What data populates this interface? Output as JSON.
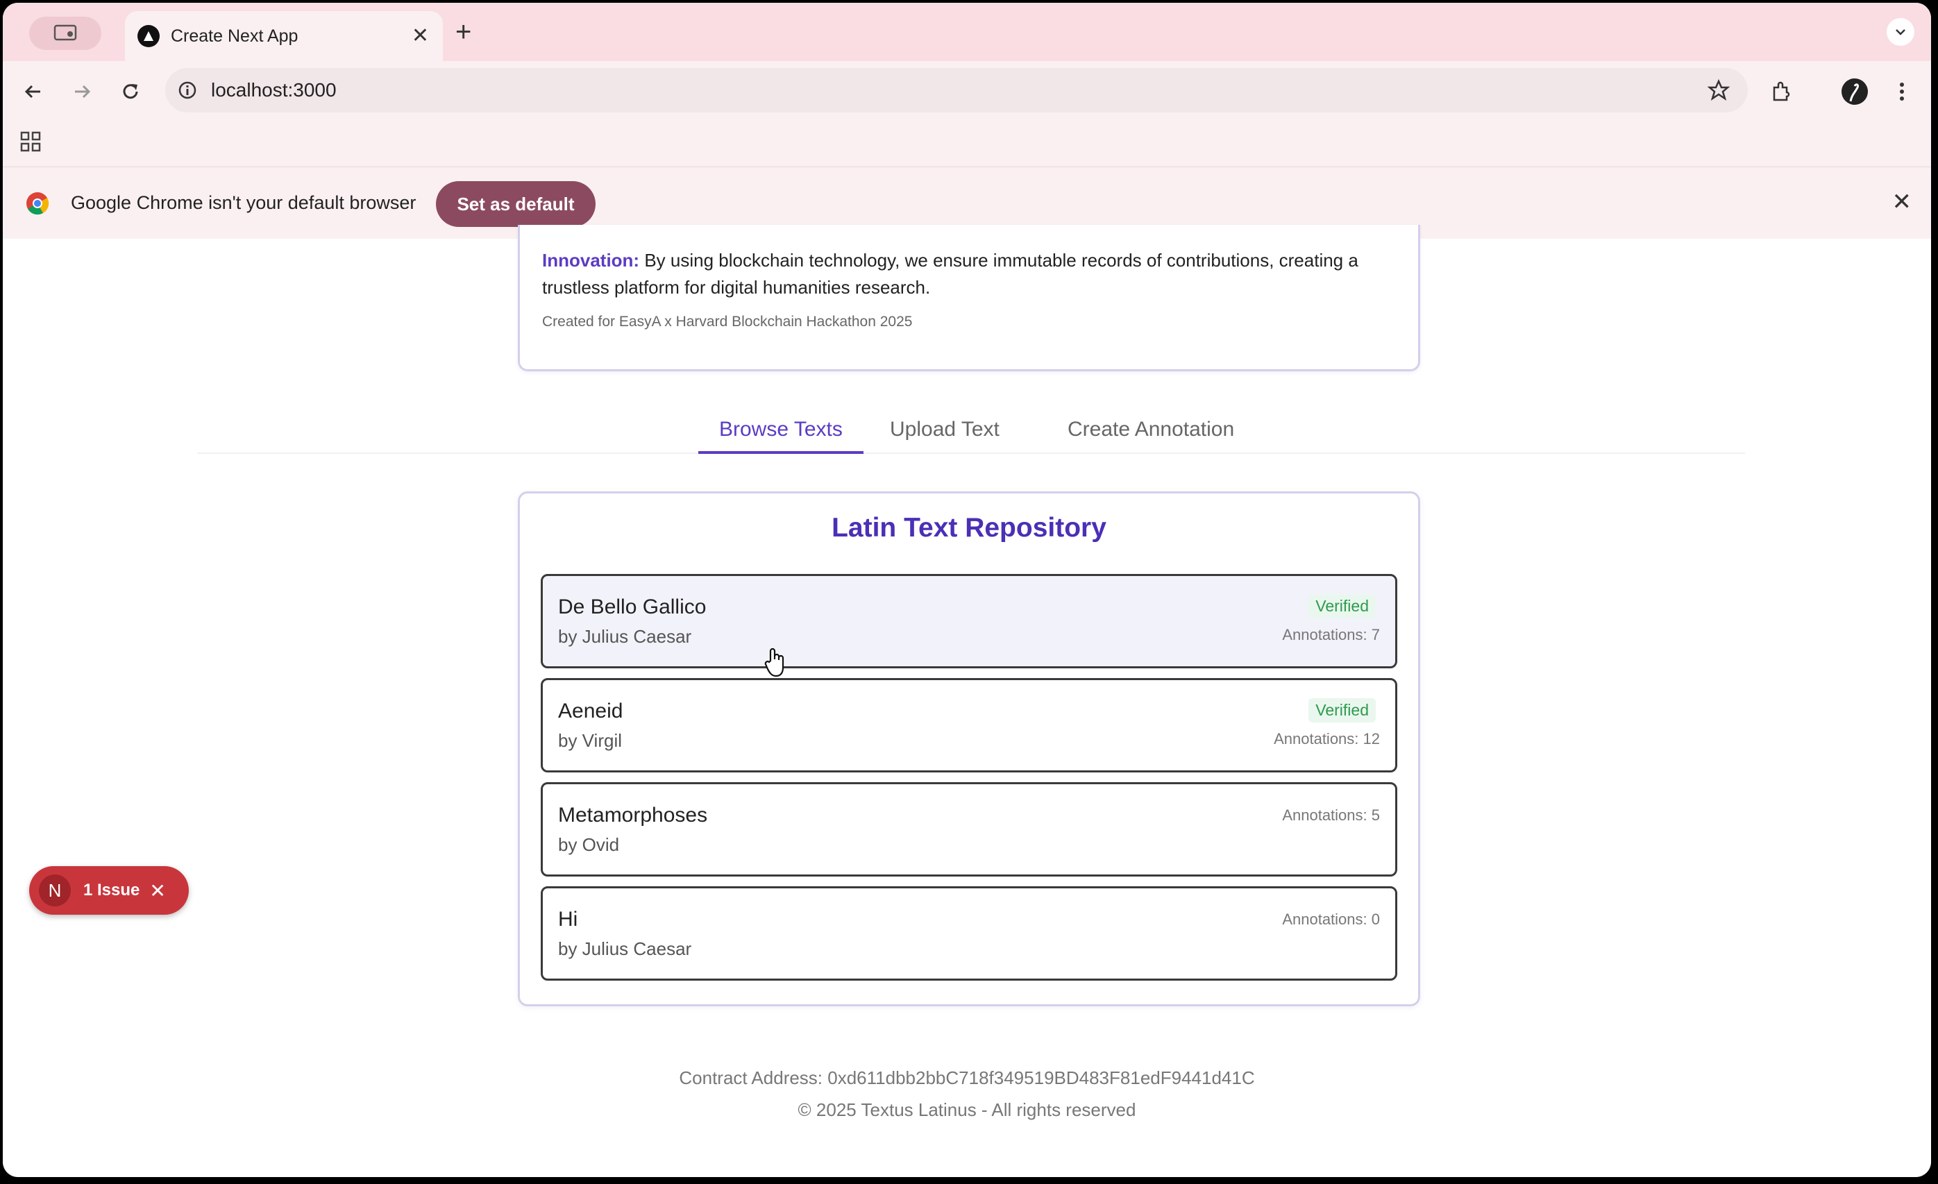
{
  "browser": {
    "tab_title": "Create Next App",
    "url": "localhost:3000"
  },
  "infobar": {
    "message": "Google Chrome isn't your default browser",
    "button_label": "Set as default"
  },
  "intro": {
    "innovation_label": "Innovation:",
    "innovation_text": " By using blockchain technology, we ensure immutable records of contributions, creating a trustless platform for digital humanities research.",
    "credit": "Created for EasyA x Harvard Blockchain Hackathon 2025"
  },
  "tabs": [
    {
      "label": "Browse Texts",
      "active": true
    },
    {
      "label": "Upload Text",
      "active": false
    },
    {
      "label": "Create Annotation",
      "active": false
    }
  ],
  "repository": {
    "title": "Latin Text Repository",
    "items": [
      {
        "title": "De Bello Gallico",
        "author": "by Julius Caesar",
        "verified": "Verified",
        "annotations": "Annotations: 7"
      },
      {
        "title": "Aeneid",
        "author": "by Virgil",
        "verified": "Verified",
        "annotations": "Annotations: 12"
      },
      {
        "title": "Metamorphoses",
        "author": "by Ovid",
        "verified": "",
        "annotations": "Annotations: 5"
      },
      {
        "title": "Hi",
        "author": "by Julius Caesar",
        "verified": "",
        "annotations": "Annotations: 0"
      }
    ]
  },
  "footer": {
    "contract": "Contract Address: 0xd611dbb2bbC718f349519BD483F81edF9441d41C",
    "copyright": "© 2025 Textus Latinus - All rights reserved"
  },
  "dev_overlay": {
    "badge_letter": "N",
    "issue_label": "1 Issue"
  },
  "colors": {
    "accent": "#5b3cc4",
    "verified": "#2e9a4e",
    "issue": "#c8363c",
    "chrome_button": "#8c4a60"
  }
}
